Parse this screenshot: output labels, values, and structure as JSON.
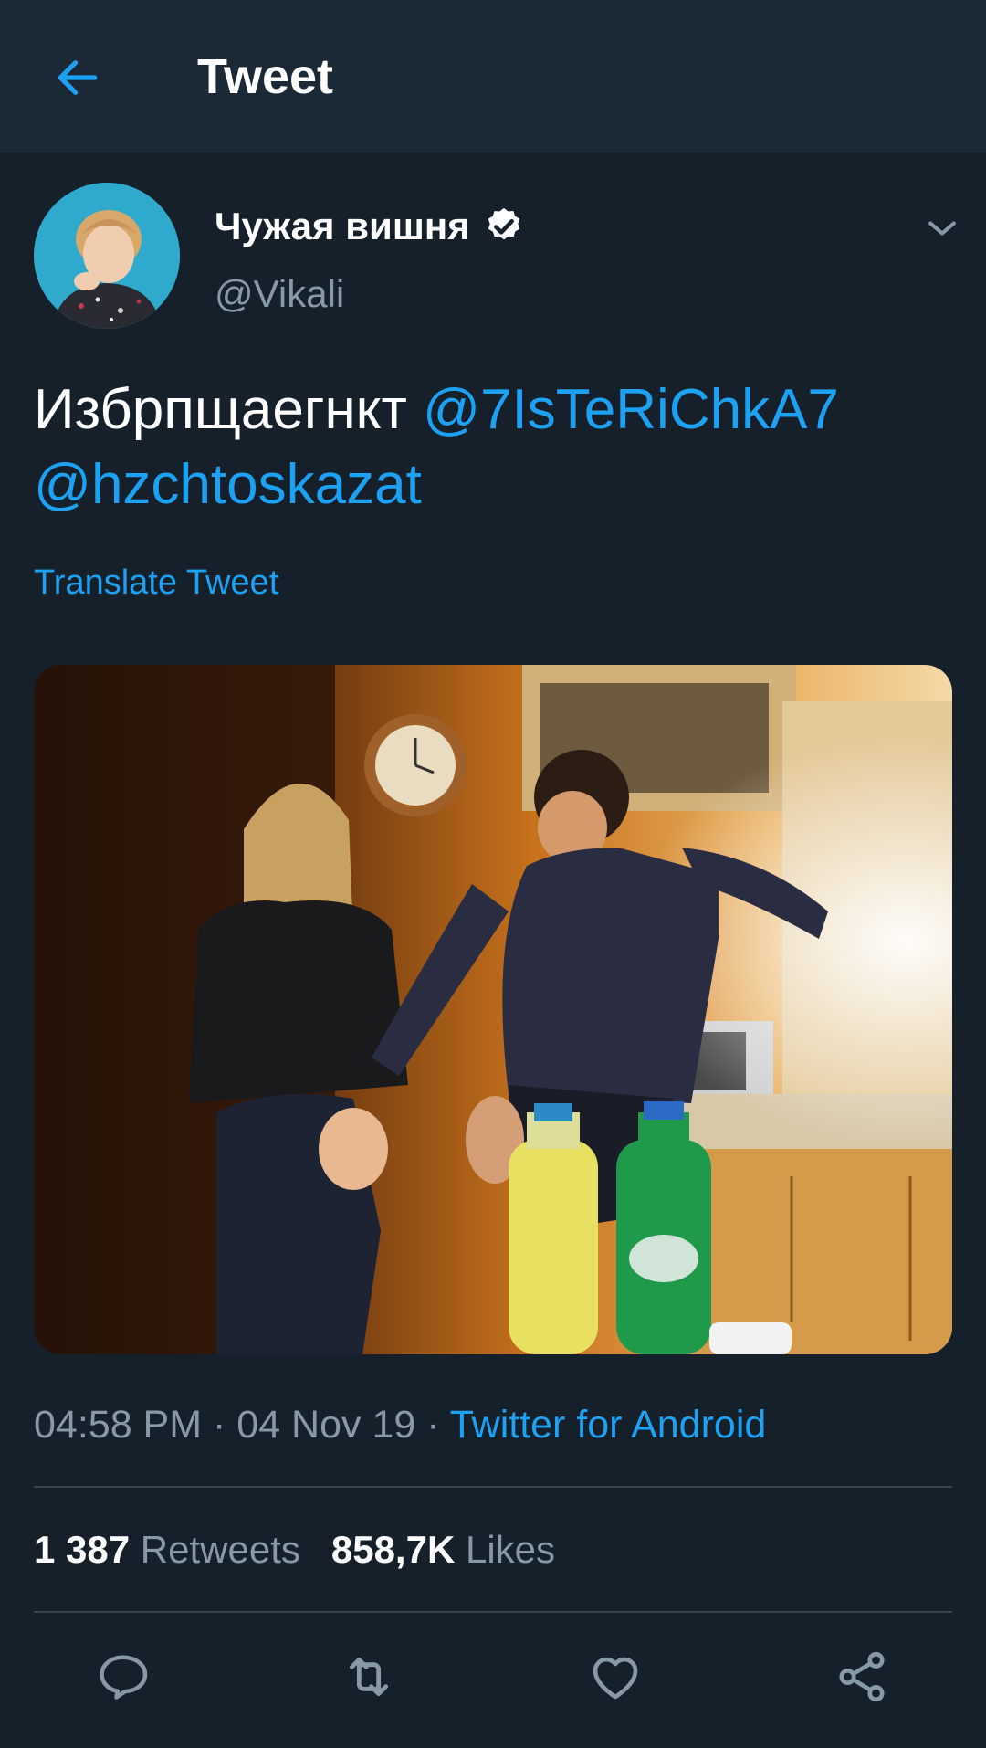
{
  "header": {
    "title": "Tweet",
    "back_icon": "arrow-left-icon"
  },
  "author": {
    "display_name": "Чужая вишня",
    "handle": "@Vikali",
    "verified_icon": "verified-badge-icon",
    "menu_icon": "chevron-down-icon"
  },
  "tweet": {
    "text": "Избрпщаегнкт",
    "mentions": [
      "@7IsTeRiChkA7",
      "@hzchtoskazat"
    ],
    "translate_label": "Translate Tweet"
  },
  "meta": {
    "time": "04:58 PM",
    "separator": " · ",
    "date": "04 Nov 19",
    "source": "Twitter for Android"
  },
  "stats": {
    "retweets_count": "1 387",
    "retweets_label": "Retweets",
    "likes_count": "858,7K",
    "likes_label": "Likes"
  },
  "actions": [
    {
      "icon": "reply-icon"
    },
    {
      "icon": "retweet-icon"
    },
    {
      "icon": "like-icon"
    },
    {
      "icon": "share-icon"
    }
  ],
  "colors": {
    "background": "#15202b",
    "header": "#1b2836",
    "accent": "#1da1f2",
    "secondary_text": "#8899a6",
    "divider": "#38444d"
  }
}
